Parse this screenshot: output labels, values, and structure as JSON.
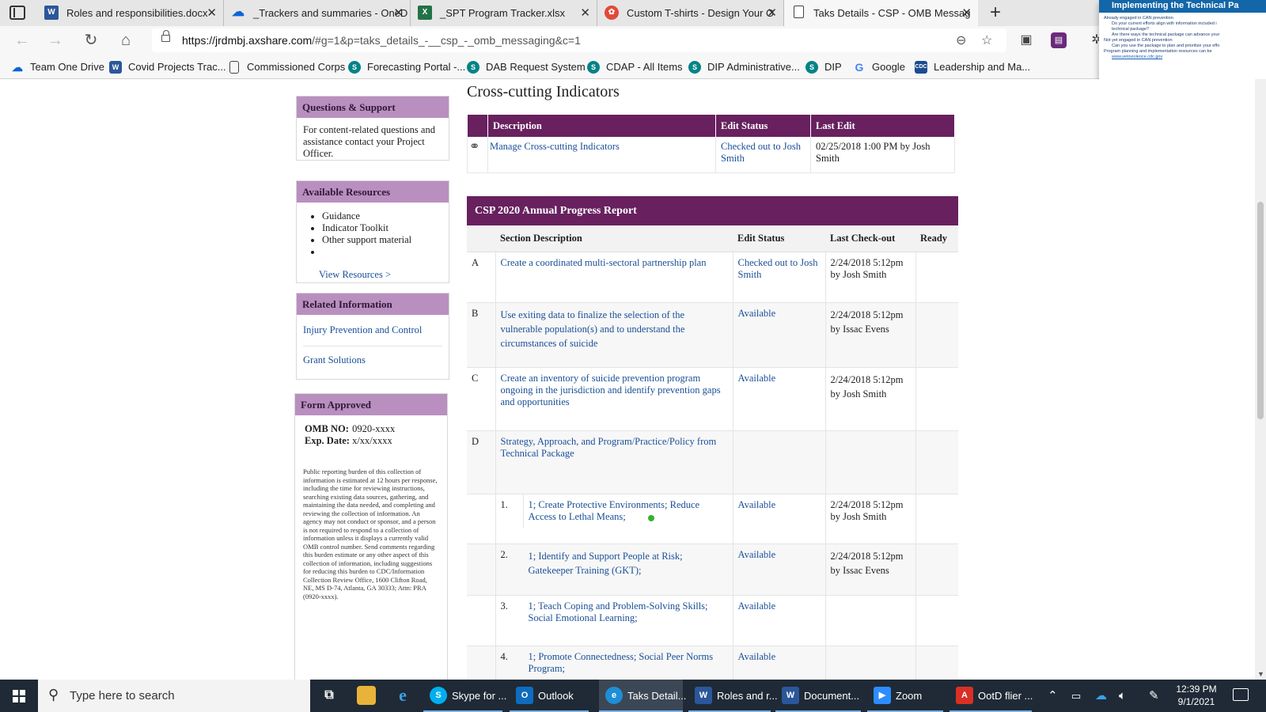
{
  "browser": {
    "tabs": [
      {
        "label": "Roles and responsibilities.docx",
        "icon": "word-icon"
      },
      {
        "label": "_Trackers and summaries - OneD",
        "icon": "onedrive-icon"
      },
      {
        "label": "_SPT Program Tracker.xlsx",
        "icon": "excel-icon"
      },
      {
        "label": "Custom T-shirts - Design Your O",
        "icon": "custom-ink-icon"
      },
      {
        "label": "Taks Details - CSP - OMB Messag",
        "icon": "page-icon",
        "active": true
      }
    ],
    "url_domain": "https://jrdmbj.axshare.com",
    "url_path": "/#g=1&p=taks_details_-__csp_-_omb_messaging&c=1",
    "bookmarks": [
      {
        "label": "Team One Drive",
        "icon": "onedrive-icon"
      },
      {
        "label": "Covid Projects Trac...",
        "icon": "word-icon"
      },
      {
        "label": "Commissioned Corps",
        "icon": "page-icon"
      },
      {
        "label": "Forecasting Portal -...",
        "icon": "sharepoint-icon"
      },
      {
        "label": "DAB Request System",
        "icon": "sharepoint-icon"
      },
      {
        "label": "CDAP - All Items",
        "icon": "sharepoint-icon"
      },
      {
        "label": "DIP Administrative...",
        "icon": "sharepoint-icon"
      },
      {
        "label": "DIP",
        "icon": "sharepoint-icon"
      },
      {
        "label": "Google",
        "icon": "google-icon"
      },
      {
        "label": "Leadership and Ma...",
        "icon": "cdc-icon"
      }
    ]
  },
  "popup": {
    "title": "Implementing the Technical Pa",
    "lines": [
      "Already engaged in CAN prevention",
      "Do your current efforts align with information included i",
      "technical package?",
      "Are there ways the technical package can advance your",
      "Not yet engaged in CAN prevention",
      "Can you use the package to plan and prioritize your effo",
      "Program planning and implementation resources can be"
    ],
    "link": "www.vetoviolence.cdc.gov"
  },
  "sidebar": {
    "questions": {
      "title": "Questions & Support",
      "text": "For content-related questions and assistance contact your Project Officer."
    },
    "resources": {
      "title": "Available Resources",
      "items": [
        "Guidance",
        "Indicator Toolkit",
        "Other support material",
        ""
      ],
      "view_link": "View Resources >"
    },
    "related": {
      "title": "Related Information",
      "links": [
        "Injury Prevention and Control",
        "Grant Solutions"
      ]
    },
    "form": {
      "title": "Form Approved",
      "omb_label": "OMB NO:",
      "omb_value": "0920-xxxx",
      "exp_label": "Exp. Date:",
      "exp_value": "x/xx/xxxx",
      "fine_print": "Public reporting burden of this collection of information is estimated at 12 hours per response, including the time for reviewing instructions, searching existing data sources, gathering, and maintaining the data needed, and completing and reviewing the collection of information. An agency may not conduct or sponsor, and a person is not required to respond to a collection of information unless it displays a currently valid OMB control number.  Send comments regarding this burden estimate or any other aspect of this collection of information, including suggestions for reducing this burden to CDC/Information Collection Review Office, 1600 Clifton Road, NE, MS D-74, Atlanta, GA 30333; Attn: PRA (0920-xxxx)."
    }
  },
  "cross_cutting": {
    "title": "Cross-cutting Indicators",
    "headers": [
      "Description",
      "Edit Status",
      "Last Edit"
    ],
    "row": {
      "description": "Manage Cross-cutting Indicators",
      "status": "Checked out to Josh Smith",
      "last_edit": "02/25/2018 1:00 PM by Josh Smith"
    }
  },
  "report": {
    "title": "CSP 2020 Annual Progress Report",
    "headers": [
      "Section Description",
      "Edit Status",
      "Last Check-out",
      "Ready"
    ],
    "sections": [
      {
        "letter": "A",
        "description": "Create a coordinated multi-sectoral partnership plan",
        "status": "Checked out to Josh Smith",
        "checkout": "2/24/2018 5:12pm by Josh Smith"
      },
      {
        "letter": "B",
        "description": "Use exiting data to finalize the selection of the vulnerable population(s) and to understand the circumstances of suicide",
        "status": "Available",
        "checkout": "2/24/2018 5:12pm by Issac Evens"
      },
      {
        "letter": "C",
        "description": "Create an inventory of suicide prevention program ongoing in the jurisdiction and identify prevention gaps and opportunities",
        "status": "Available",
        "checkout": "2/24/2018 5:12pm by Josh Smith"
      },
      {
        "letter": "D",
        "description": "Strategy, Approach, and Program/Practice/Policy from Technical Package",
        "status": "",
        "checkout": ""
      }
    ],
    "subitems": [
      {
        "num": "1.",
        "description": "1; Create Protective Environments; Reduce Access to Lethal Means;",
        "status": "Available",
        "checkout": "2/24/2018 5:12pm by Josh Smith"
      },
      {
        "num": "2.",
        "description": "1; Identify and Support People at Risk; Gatekeeper Training (GKT);",
        "status": "Available",
        "checkout": "2/24/2018 5:12pm by Issac Evens"
      },
      {
        "num": "3.",
        "description": "1; Teach Coping and Problem-Solving Skills; Social Emotional Learning;",
        "status": "Available",
        "checkout": ""
      },
      {
        "num": "4.",
        "description": "1; Promote Connectedness; Social Peer Norms Program;",
        "status": "Available",
        "checkout": ""
      }
    ]
  },
  "taskbar": {
    "search_placeholder": "Type here to search",
    "apps": [
      {
        "label": "Skype for ...",
        "icon": "skype-icon"
      },
      {
        "label": "Outlook",
        "icon": "outlook-icon"
      },
      {
        "label": "Taks Detail...",
        "icon": "edge-icon",
        "active": true
      },
      {
        "label": "Roles and r...",
        "icon": "word-icon"
      },
      {
        "label": "Document...",
        "icon": "word-icon"
      },
      {
        "label": "Zoom",
        "icon": "zoom-icon"
      },
      {
        "label": "OotD flier ...",
        "icon": "pdf-icon"
      }
    ],
    "time": "12:39 PM",
    "date": "9/1/2021"
  },
  "colors": {
    "purple_header": "#68205f",
    "sidebar_header": "#b98fbf",
    "link": "#1a4f96",
    "taskbar": "#1f2a36"
  }
}
